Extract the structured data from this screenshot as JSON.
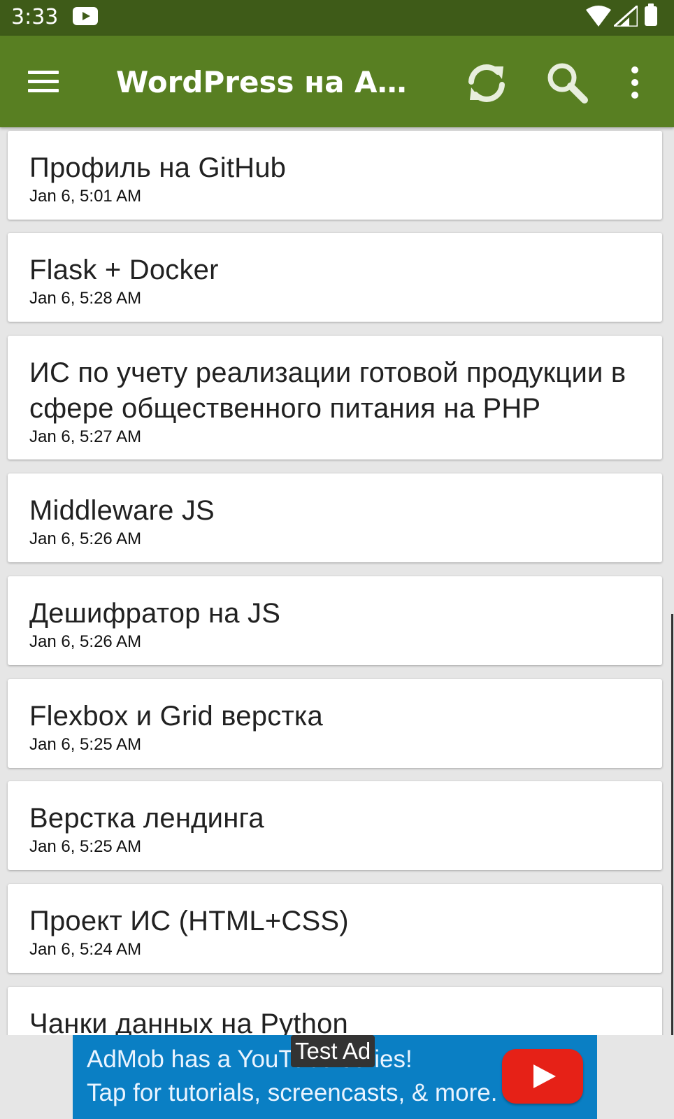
{
  "status_bar": {
    "time": "3:33",
    "icons": [
      "youtube-notification-icon",
      "wifi-icon",
      "cell-signal-icon",
      "battery-icon"
    ]
  },
  "app_bar": {
    "title": "WordPress на Andr…",
    "actions": [
      "menu-icon",
      "refresh-icon",
      "search-icon",
      "more-vert-icon"
    ],
    "color": "#587f22"
  },
  "posts": [
    {
      "title": "Профиль на GitHub",
      "date": "Jan 6, 5:01 AM"
    },
    {
      "title": "Flask + Docker",
      "date": "Jan 6, 5:28 AM"
    },
    {
      "title": "ИС по учету реализации готовой продукции в сфере общественного питания на PHP",
      "date": "Jan 6, 5:27 AM"
    },
    {
      "title": "Middleware JS",
      "date": "Jan 6, 5:26 AM"
    },
    {
      "title": "Дешифратор на JS",
      "date": "Jan 6, 5:26 AM"
    },
    {
      "title": "Flexbox и Grid верстка",
      "date": "Jan 6, 5:25 AM"
    },
    {
      "title": "Верстка лендинга",
      "date": "Jan 6, 5:25 AM"
    },
    {
      "title": "Проект ИС (HTML+CSS)",
      "date": "Jan 6, 5:24 AM"
    },
    {
      "title": "Чанки данных на Python",
      "date": ""
    }
  ],
  "ad": {
    "label": "Test Ad",
    "line1": "AdMob has a YouTube series!",
    "line2": "Tap for tutorials, screencasts, & more.",
    "color": "#0a7fc4"
  }
}
